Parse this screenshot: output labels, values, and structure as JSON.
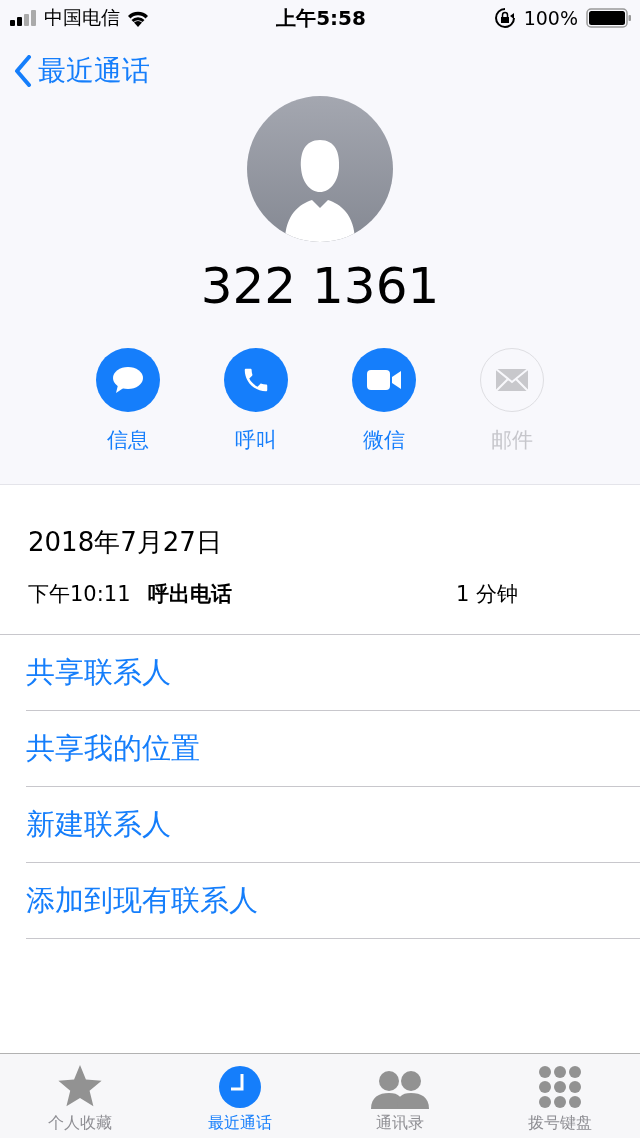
{
  "status_bar": {
    "carrier": "中国电信",
    "time": "上午5:58",
    "battery": "100%"
  },
  "nav": {
    "back": "最近通话"
  },
  "contact": {
    "number": "322 1361"
  },
  "actions": [
    {
      "kind": "message",
      "label": "信息",
      "disabled": false
    },
    {
      "kind": "phone",
      "label": "呼叫",
      "disabled": false
    },
    {
      "kind": "video",
      "label": "微信",
      "disabled": false
    },
    {
      "kind": "mail",
      "label": "邮件",
      "disabled": true
    }
  ],
  "call_log": {
    "date": "2018年7月27日",
    "entries": [
      {
        "time": "下午10:11",
        "type": "呼出电话",
        "duration": "1 分钟"
      }
    ]
  },
  "menu": [
    "共享联系人",
    "共享我的位置",
    "新建联系人",
    "添加到现有联系人"
  ],
  "tab_bar": [
    {
      "kind": "star",
      "label": "个人收藏",
      "selected": false
    },
    {
      "kind": "clock",
      "label": "最近通话",
      "selected": true
    },
    {
      "kind": "people",
      "label": "通讯录",
      "selected": false
    },
    {
      "kind": "keypad",
      "label": "拨号键盘",
      "selected": false
    }
  ]
}
